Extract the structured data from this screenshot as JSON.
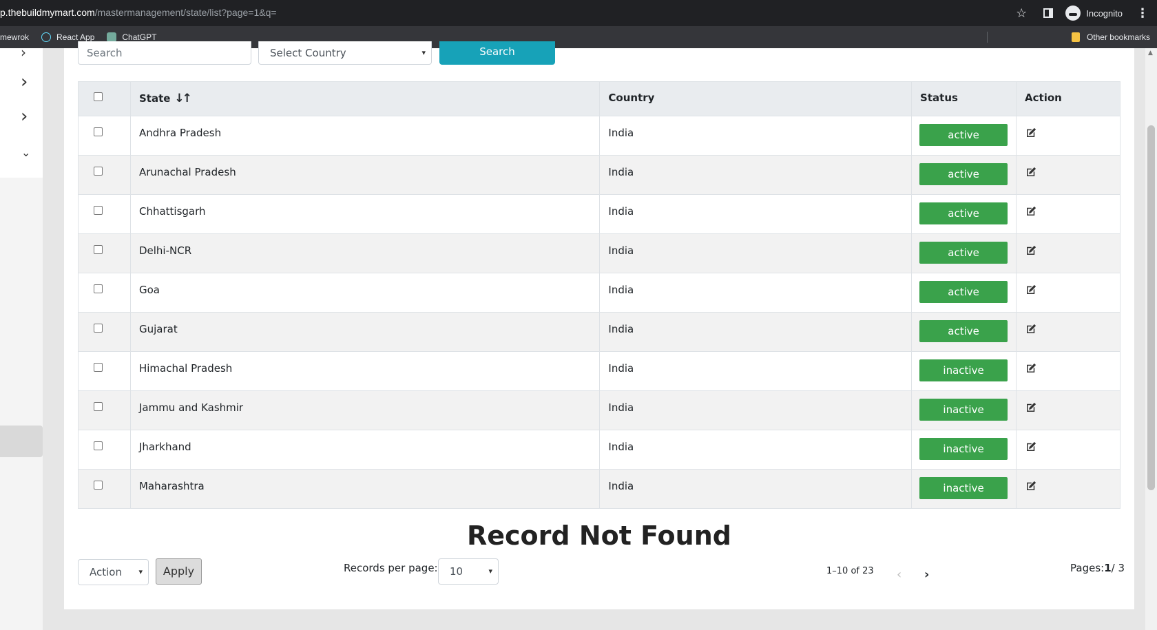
{
  "browser": {
    "url_host": "p.thebuildmymart.com",
    "url_path": "/mastermanagement/state/list?page=1&q=",
    "profile": "Incognito",
    "bookmarks": [
      "mewrok",
      "React App",
      "ChatGPT"
    ],
    "other_bookmarks": "Other bookmarks"
  },
  "filters": {
    "search_placeholder": "Search",
    "country_select": "Select Country",
    "search_button": "Search"
  },
  "table": {
    "headers": {
      "state": "State",
      "country": "Country",
      "status": "Status",
      "action": "Action"
    },
    "sort_icon": "↓↑",
    "rows": [
      {
        "state": "Andhra Pradesh",
        "country": "India",
        "status": "active"
      },
      {
        "state": "Arunachal Pradesh",
        "country": "India",
        "status": "active"
      },
      {
        "state": "Chhattisgarh",
        "country": "India",
        "status": "active"
      },
      {
        "state": "Delhi-NCR",
        "country": "India",
        "status": "active"
      },
      {
        "state": "Goa",
        "country": "India",
        "status": "active"
      },
      {
        "state": "Gujarat",
        "country": "India",
        "status": "active"
      },
      {
        "state": "Himachal Pradesh",
        "country": "India",
        "status": "inactive"
      },
      {
        "state": "Jammu and Kashmir",
        "country": "India",
        "status": "inactive"
      },
      {
        "state": "Jharkhand",
        "country": "India",
        "status": "inactive"
      },
      {
        "state": "Maharashtra",
        "country": "India",
        "status": "inactive"
      }
    ]
  },
  "empty_message": "Record Not Found",
  "footer": {
    "bulk_action": "Action",
    "apply_button": "Apply",
    "records_per_page_label": "Records per page:",
    "records_per_page_value": "10",
    "range_text": "1–10 of 23",
    "pages_label": "Pages:",
    "current_page": "1",
    "total_pages": "/ 3"
  },
  "colors": {
    "badge": "#3aa24b",
    "search_button": "#17a2b8",
    "header_bg": "#e9ecef"
  }
}
